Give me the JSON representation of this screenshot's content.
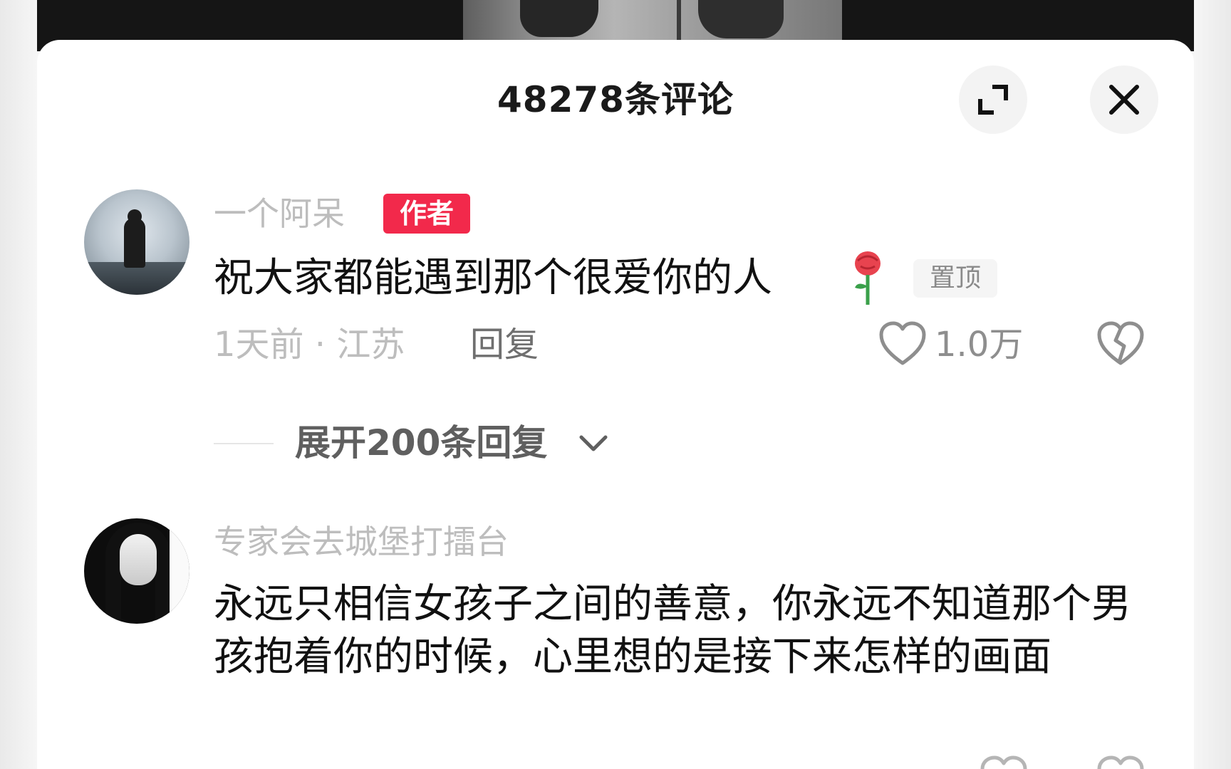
{
  "header": {
    "title": "48278条评论",
    "expand_icon": "expand-icon",
    "close_icon": "close-icon"
  },
  "comments": [
    {
      "username": "一个阿呆",
      "badge": "作者",
      "text": "祝大家都能遇到那个很爱你的人",
      "emoji": "rose-icon",
      "pinned_label": "置顶",
      "meta": "1天前 · 江苏",
      "reply_label": "回复",
      "likes": "1.0万",
      "expand_label": "展开200条回复"
    },
    {
      "username": "专家会去城堡打擂台",
      "text": "永远只相信女孩子之间的善意，你永远不知道那个男孩抱着你的时候，心里想的是接下来怎样的画面"
    }
  ],
  "colors": {
    "author_badge": "#f2294b",
    "sheet_bg": "#ffffff",
    "muted_text": "#bdbdbd"
  }
}
